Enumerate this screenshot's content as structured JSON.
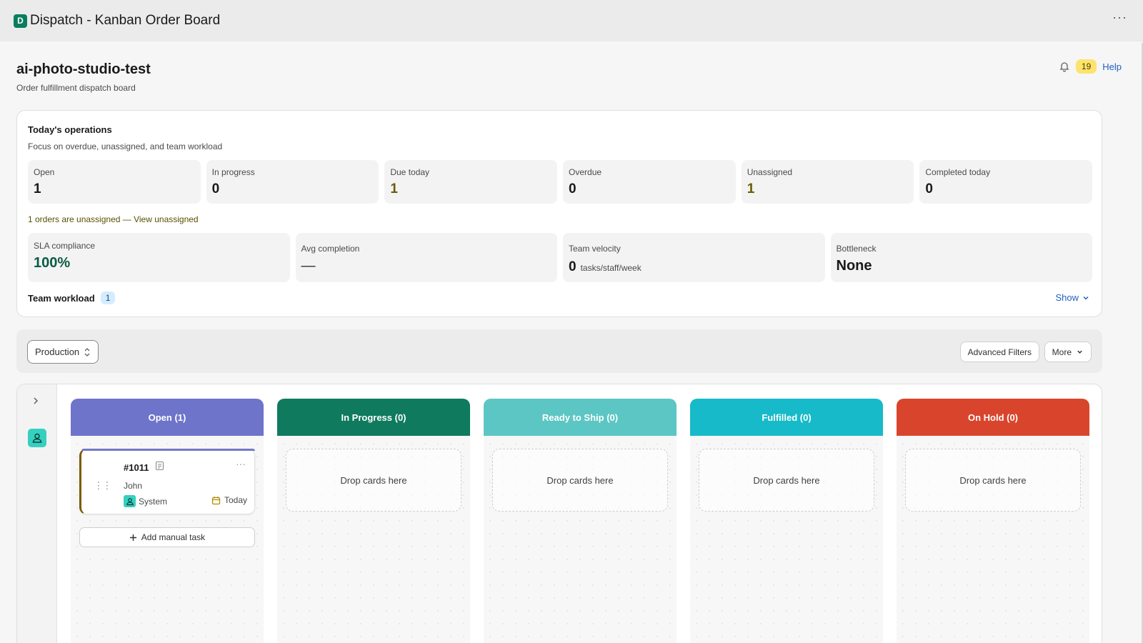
{
  "app": {
    "logo_letter": "D",
    "title": "Dispatch - Kanban Order Board",
    "more": "···"
  },
  "header": {
    "store_name": "ai-photo-studio-test",
    "subtitle": "Order fulfillment dispatch board",
    "notification_count": "19",
    "help_label": "Help"
  },
  "ops": {
    "title": "Today's operations",
    "subtitle": "Focus on overdue, unassigned, and team workload",
    "stats": [
      {
        "label": "Open",
        "value": "1"
      },
      {
        "label": "In progress",
        "value": "0"
      },
      {
        "label": "Due today",
        "value": "1"
      },
      {
        "label": "Overdue",
        "value": "0"
      },
      {
        "label": "Unassigned",
        "value": "1"
      },
      {
        "label": "Completed today",
        "value": "0"
      }
    ],
    "unassigned_note": "1 orders are unassigned — ",
    "unassigned_link": "View unassigned",
    "metrics": {
      "sla": {
        "label": "SLA compliance",
        "value": "100%"
      },
      "avg": {
        "label": "Avg completion",
        "value": "—"
      },
      "velocity": {
        "label": "Team velocity",
        "value": "0",
        "unit": "tasks/staff/week"
      },
      "bottleneck": {
        "label": "Bottleneck",
        "value": "None"
      }
    },
    "workload_label": "Team workload",
    "workload_count": "1",
    "show_label": "Show"
  },
  "toolbar": {
    "view_select": "Production",
    "advanced_filters": "Advanced Filters",
    "more": "More"
  },
  "columns": [
    {
      "title": "Open (1)",
      "color": "#6e74c9"
    },
    {
      "title": "In Progress (0)",
      "color": "#0f7a5e",
      "empty": "Drop cards here"
    },
    {
      "title": "Ready to Ship (0)",
      "color": "#5cc6c4",
      "empty": "Drop cards here"
    },
    {
      "title": "Fulfilled (0)",
      "color": "#17bac8",
      "empty": "Drop cards here"
    },
    {
      "title": "On Hold (0)",
      "color": "#d9452c",
      "empty": "Drop cards here"
    }
  ],
  "card": {
    "id": "#1011",
    "customer": "John",
    "assignee": "System",
    "due": "Today"
  },
  "add_task_label": "Add manual task",
  "colors": {
    "brand": "#0b7d5f",
    "badge": "#fde36e",
    "link": "#1f5fbf",
    "sla": "#0b5b45"
  }
}
